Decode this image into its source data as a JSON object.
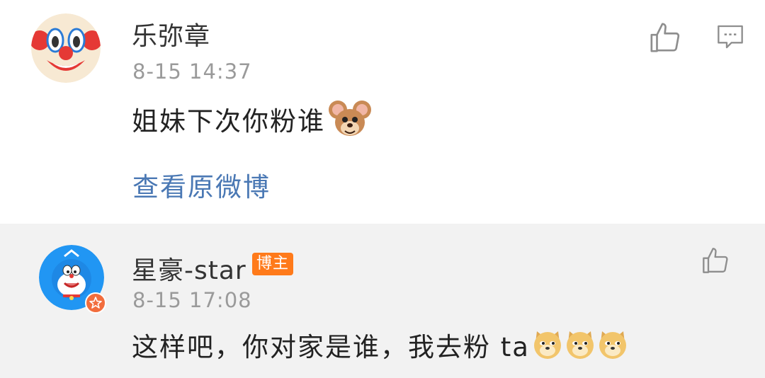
{
  "comments": [
    {
      "username": "乐弥章",
      "timestamp": "8-15 14:37",
      "text": "姐妹下次你粉谁",
      "emoji": "jerry-mouse-emoji",
      "view_link": "查看原微博"
    }
  ],
  "reply": {
    "username": "星豪-star",
    "badge": "博主",
    "timestamp": "8-15 17:08",
    "text": "这样吧，你对家是谁，我去粉 ta",
    "emojis": [
      "doge-emoji",
      "doge-emoji",
      "doge-emoji"
    ]
  },
  "icons": {
    "like": "thumbs-up-icon",
    "comment": "comment-bubble-icon",
    "verified": "verified-star-icon"
  },
  "colors": {
    "link": "#4a78b4",
    "badge": "#ff7a1a",
    "reply_background": "#f2f2f2",
    "timestamp": "#9a9a9a"
  }
}
